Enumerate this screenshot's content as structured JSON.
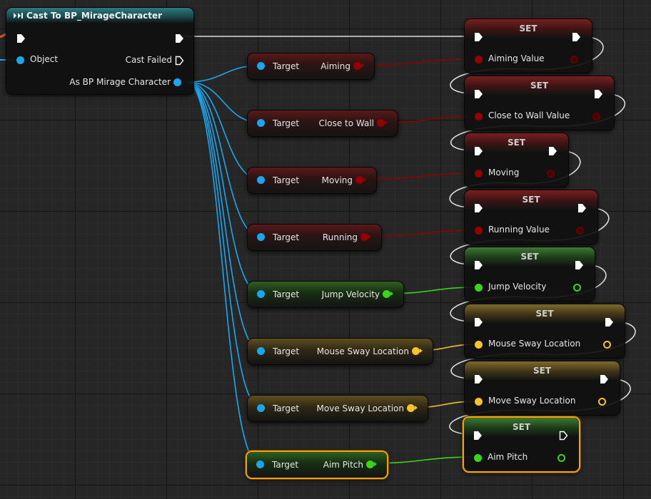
{
  "colors": {
    "object_pin": "#1aa6ee",
    "bool_pin": "#950000",
    "vector_pin": "#f5c22a",
    "float_pin": "#39d618",
    "selection": "#f2a20a",
    "exec_wire": "#dcdcdc"
  },
  "cast_node": {
    "title": "Cast To BP_MirageCharacter",
    "icon": "cast-arrows-icon",
    "object_label": "Object",
    "cast_failed_label": "Cast Failed",
    "as_label": "As BP Mirage Character"
  },
  "getters": [
    {
      "target_label": "Target",
      "var_label": "Aiming",
      "pin_type": "bool",
      "selected": false
    },
    {
      "target_label": "Target",
      "var_label": "Close to Wall",
      "pin_type": "bool",
      "selected": false
    },
    {
      "target_label": "Target",
      "var_label": "Moving",
      "pin_type": "bool",
      "selected": false
    },
    {
      "target_label": "Target",
      "var_label": "Running",
      "pin_type": "bool",
      "selected": false
    },
    {
      "target_label": "Target",
      "var_label": "Jump Velocity",
      "pin_type": "float",
      "selected": false
    },
    {
      "target_label": "Target",
      "var_label": "Mouse Sway Location",
      "pin_type": "vector",
      "selected": false
    },
    {
      "target_label": "Target",
      "var_label": "Move Sway Location",
      "pin_type": "vector",
      "selected": false
    },
    {
      "target_label": "Target",
      "var_label": "Aim Pitch",
      "pin_type": "float",
      "selected": true
    }
  ],
  "setters": [
    {
      "title": "SET",
      "var_label": "Aiming Value",
      "pin_type": "bool",
      "selected": false
    },
    {
      "title": "SET",
      "var_label": "Close to Wall Value",
      "pin_type": "bool",
      "selected": false
    },
    {
      "title": "SET",
      "var_label": "Moving",
      "pin_type": "bool",
      "selected": false
    },
    {
      "title": "SET",
      "var_label": "Running Value",
      "pin_type": "bool",
      "selected": false
    },
    {
      "title": "SET",
      "var_label": "Jump Velocity",
      "pin_type": "float",
      "selected": false
    },
    {
      "title": "SET",
      "var_label": "Mouse Sway Location",
      "pin_type": "vector",
      "selected": false
    },
    {
      "title": "SET",
      "var_label": "Move Sway Location",
      "pin_type": "vector",
      "selected": false
    },
    {
      "title": "SET",
      "var_label": "Aim Pitch",
      "pin_type": "float",
      "selected": true
    }
  ]
}
